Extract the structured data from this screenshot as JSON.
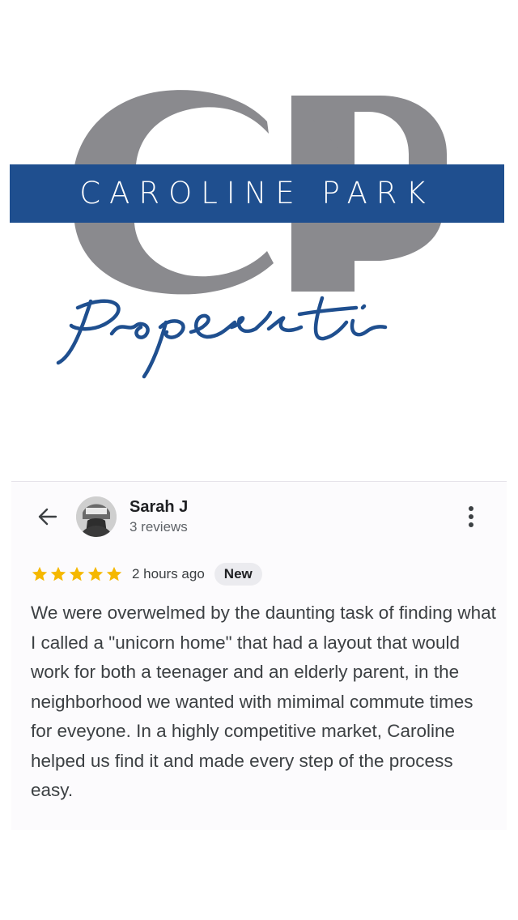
{
  "logo": {
    "brand": "CAROLINE PARK",
    "script_word": "Properti",
    "monogram": "CP",
    "colors": {
      "banner": "#1f4f8f",
      "monogram": "#8a8a8e",
      "script": "#1f4f8f"
    }
  },
  "review": {
    "back_icon": "arrow-left-icon",
    "more_icon": "more-vertical-icon",
    "reviewer": {
      "name": "Sarah J",
      "review_count": "3 reviews"
    },
    "rating": 5,
    "rating_max": 5,
    "star_color": "#f5b800",
    "time": "2 hours ago",
    "badge": "New",
    "text": "We were overwelmed by the daunting task of finding what I called a \"unicorn home\" that had a layout that would work for both a teenager and an elderly parent, in the neighborhood we wanted with mimimal commute times for eveyone. In a highly competitive market, Caroline helped us find it and made every step of the process easy."
  }
}
